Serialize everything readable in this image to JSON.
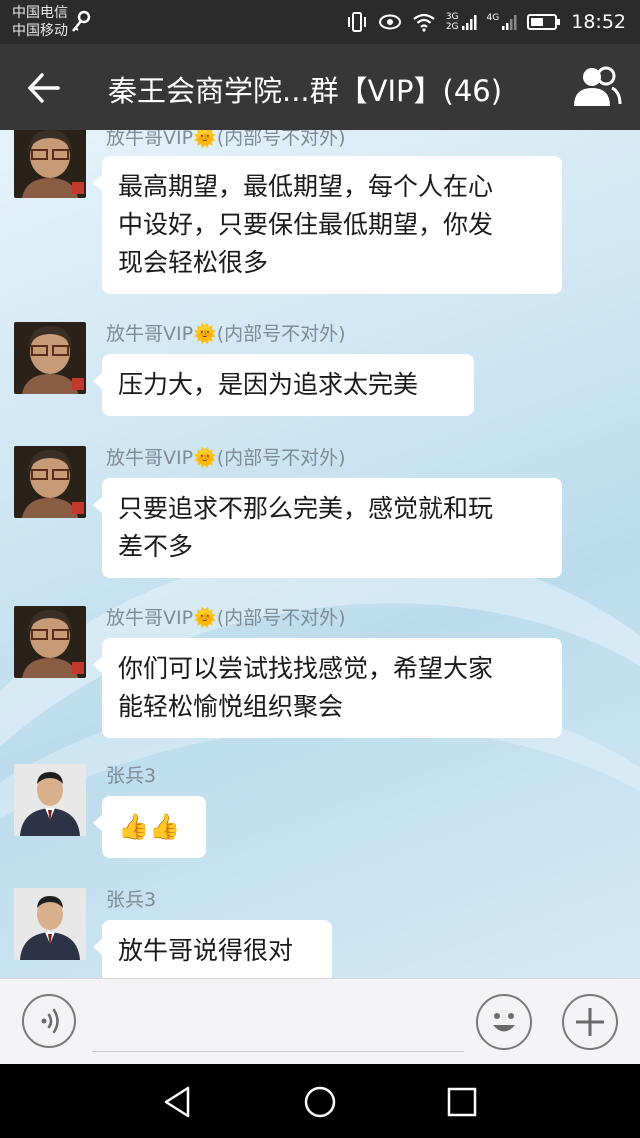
{
  "status_bar": {
    "carrier_1": "中国电信",
    "carrier_2": "中国移动",
    "net_top": "3G",
    "net_bottom": "2G",
    "net_4g": "4G",
    "time": "18:52"
  },
  "header": {
    "title": "秦王会商学院...群【VIP】(46)",
    "back_icon": "arrow-left-icon",
    "members_icon": "group-members-icon"
  },
  "messages": [
    {
      "sender": "放牛哥VIP🌞(内部号不对外)",
      "lines": [
        "最高期望，最低期望，每个人在心",
        "中设好，只要保住最低期望，你发",
        "现会轻松很多"
      ]
    },
    {
      "sender": "放牛哥VIP🌞(内部号不对外)",
      "lines": [
        "压力大，是因为追求太完美"
      ]
    },
    {
      "sender": "放牛哥VIP🌞(内部号不对外)",
      "lines": [
        "只要追求不那么完美，感觉就和玩",
        "差不多"
      ]
    },
    {
      "sender": "放牛哥VIP🌞(内部号不对外)",
      "lines": [
        "你们可以尝试找找感觉，希望大家",
        "能轻松愉悦组织聚会"
      ]
    },
    {
      "sender": "张兵3",
      "lines": [
        "👍👍"
      ]
    },
    {
      "sender": "张兵3",
      "lines": [
        "放牛哥说得很对"
      ]
    }
  ],
  "input_bar": {
    "voice_icon": "voice-icon",
    "emoji_icon": "emoji-icon",
    "plus_icon": "plus-icon"
  },
  "colors": {
    "header_bg": "#373737",
    "status_bg": "#2b2b2b",
    "sender_text": "#7e8c97"
  }
}
